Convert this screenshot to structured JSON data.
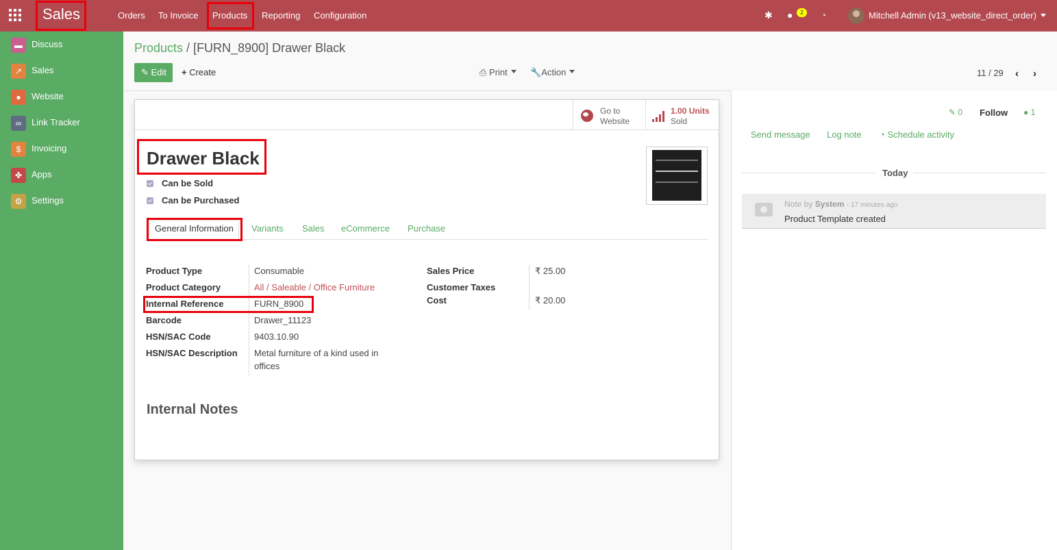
{
  "topbar": {
    "brand": "Sales",
    "menu": [
      "Orders",
      "To Invoice",
      "Products",
      "Reporting",
      "Configuration"
    ],
    "messages_count": "2",
    "user": "Mitchell Admin (v13_website_direct_order)",
    "icons": [
      "apps-grid-icon",
      "bug-icon",
      "chat-icon",
      "clock-icon"
    ]
  },
  "sidebar": {
    "items": [
      {
        "label": "Discuss",
        "icon": "discuss-icon",
        "color": "#c95e8f"
      },
      {
        "label": "Sales",
        "icon": "sales-chart-icon",
        "color": "#e0843f"
      },
      {
        "label": "Website",
        "icon": "globe-icon",
        "color": "#e06a3f"
      },
      {
        "label": "Link Tracker",
        "icon": "link-icon",
        "color": "#5e6b82"
      },
      {
        "label": "Invoicing",
        "icon": "invoice-icon",
        "color": "#e0843f"
      },
      {
        "label": "Apps",
        "icon": "apps-icon",
        "color": "#c44848"
      },
      {
        "label": "Settings",
        "icon": "gear-icon",
        "color": "#c4a248"
      }
    ]
  },
  "control": {
    "breadcrumb_parent": "Products",
    "breadcrumb_sep": "/",
    "breadcrumb_current": "[FURN_8900] Drawer Black",
    "edit": "Edit",
    "create": "Create",
    "print": "Print",
    "action": "Action",
    "pager": "11 / 29"
  },
  "smart_buttons": {
    "website_l1": "Go to",
    "website_l2": "Website",
    "units_value": "1.00 Units",
    "units_label": "Sold"
  },
  "product": {
    "name": "Drawer Black",
    "can_be_sold": "Can be Sold",
    "can_be_purchased": "Can be Purchased"
  },
  "tabs": [
    "General Information",
    "Variants",
    "Sales",
    "eCommerce",
    "Purchase"
  ],
  "fields_left": [
    {
      "label": "Product Type",
      "value": "Consumable"
    },
    {
      "label": "Product Category",
      "value": "All / Saleable / Office Furniture"
    },
    {
      "label": "Internal Reference",
      "value": "FURN_8900"
    },
    {
      "label": "Barcode",
      "value": "Drawer_11123"
    },
    {
      "label": "HSN/SAC Code",
      "value": "9403.10.90"
    },
    {
      "label": "HSN/SAC Description",
      "value_l1": "Metal furniture of a kind used in",
      "value_l2": "offices"
    }
  ],
  "fields_right": [
    {
      "label": "Sales Price",
      "value": "₹ 25.00"
    },
    {
      "label": "Customer Taxes",
      "value": ""
    },
    {
      "label": "Cost",
      "value": "₹ 20.00"
    }
  ],
  "notes_title": "Internal Notes",
  "chatter": {
    "attachments": "0",
    "follow": "Follow",
    "followers": "1",
    "send_message": "Send message",
    "log_note": "Log note",
    "schedule_activity": "Schedule activity",
    "today": "Today",
    "message": {
      "type": "Note by",
      "author": "System",
      "time": "- 17 minutes ago",
      "body": "Product Template created"
    }
  }
}
